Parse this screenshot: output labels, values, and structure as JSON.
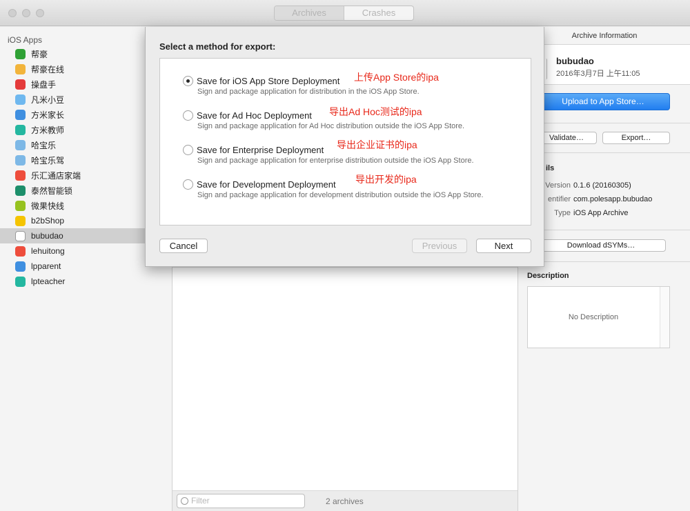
{
  "window": {
    "segments": [
      "Archives",
      "Crashes"
    ]
  },
  "sidebar": {
    "title": "iOS Apps",
    "apps": [
      {
        "label": "帮豪",
        "color": "#2fa135"
      },
      {
        "label": "帮豪在线",
        "color": "#f2b43b"
      },
      {
        "label": "操盘手",
        "color": "#e43a3a"
      },
      {
        "label": "凡米小豆",
        "color": "#6fb8ef"
      },
      {
        "label": "方米家长",
        "color": "#3f8fe0"
      },
      {
        "label": "方米教师",
        "color": "#24b7a0"
      },
      {
        "label": "哈宝乐",
        "color": "#7db8e6"
      },
      {
        "label": "哈宝乐驾",
        "color": "#7db8e6"
      },
      {
        "label": "乐汇通店家端",
        "color": "#ee4d3c"
      },
      {
        "label": "泰然智能锁",
        "color": "#1d8f6b"
      },
      {
        "label": "微果快线",
        "color": "#96c21f"
      },
      {
        "label": "b2bShop",
        "color": "#f5c400"
      },
      {
        "label": "bubudao",
        "color": "#ffffff",
        "selected": true
      },
      {
        "label": "lehuitong",
        "color": "#ee4d3c"
      },
      {
        "label": "lpparent",
        "color": "#3f8fe0"
      },
      {
        "label": "lpteacher",
        "color": "#24b7a0"
      }
    ]
  },
  "middle": {
    "filter_placeholder": "Filter",
    "archives_count": "2 archives"
  },
  "right": {
    "header": "Archive Information",
    "archive_name": "bubudao",
    "archive_date": "2016年3月7日 上午11:05",
    "upload_label": "Upload to App Store…",
    "validate_label": "Validate…",
    "export_label": "Export…",
    "details_title": "ils",
    "details": [
      {
        "key": "Version",
        "value": "0.1.6 (20160305)"
      },
      {
        "key": "entifier",
        "value": "com.polesapp.bubudao"
      },
      {
        "key": "Type",
        "value": "iOS App Archive"
      }
    ],
    "download_label": "Download dSYMs…",
    "description_title": "Description",
    "description_placeholder": "No Description"
  },
  "sheet": {
    "title": "Select a method for export:",
    "options": [
      {
        "title": "Save for iOS App Store Deployment",
        "desc": "Sign and package application for distribution in the iOS App Store.",
        "annotation": "上传App Store的ipa",
        "checked": true
      },
      {
        "title": "Save for Ad Hoc Deployment",
        "desc": "Sign and package application for Ad Hoc distribution outside the iOS App Store.",
        "annotation": "导出Ad Hoc测试的ipa",
        "checked": false
      },
      {
        "title": "Save for Enterprise Deployment",
        "desc": "Sign and package application for enterprise distribution outside the iOS App Store.",
        "annotation": "导出企业证书的ipa",
        "checked": false
      },
      {
        "title": "Save for Development Deployment",
        "desc": "Sign and package application for development distribution outside the iOS App Store.",
        "annotation": "导出开发的ipa",
        "checked": false
      }
    ],
    "cancel_label": "Cancel",
    "previous_label": "Previous",
    "next_label": "Next"
  }
}
